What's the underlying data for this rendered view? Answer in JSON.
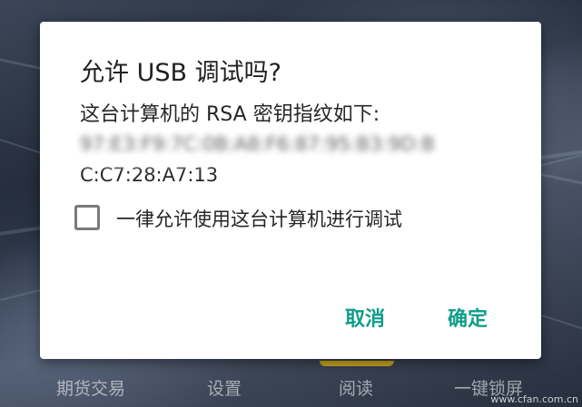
{
  "dialog": {
    "title": "允许 USB 调试吗?",
    "message": "这台计算机的 RSA 密钥指纹如下:",
    "fingerprint_blurred": "97:E3:F9:7C:0B:A8:F6:87:95:B3:9D:B",
    "fingerprint_visible": "C:C7:28:A7:13",
    "checkbox_label": "一律允许使用这台计算机进行调试",
    "checkbox_checked": false,
    "cancel_label": "取消",
    "ok_label": "确定",
    "accent_color": "#0f9d8a"
  },
  "dock": {
    "items": [
      {
        "label": "期货交易"
      },
      {
        "label": "设置"
      },
      {
        "label": "阅读"
      },
      {
        "label": "一键锁屏"
      }
    ]
  },
  "watermark": "www.cfan.com.cn"
}
